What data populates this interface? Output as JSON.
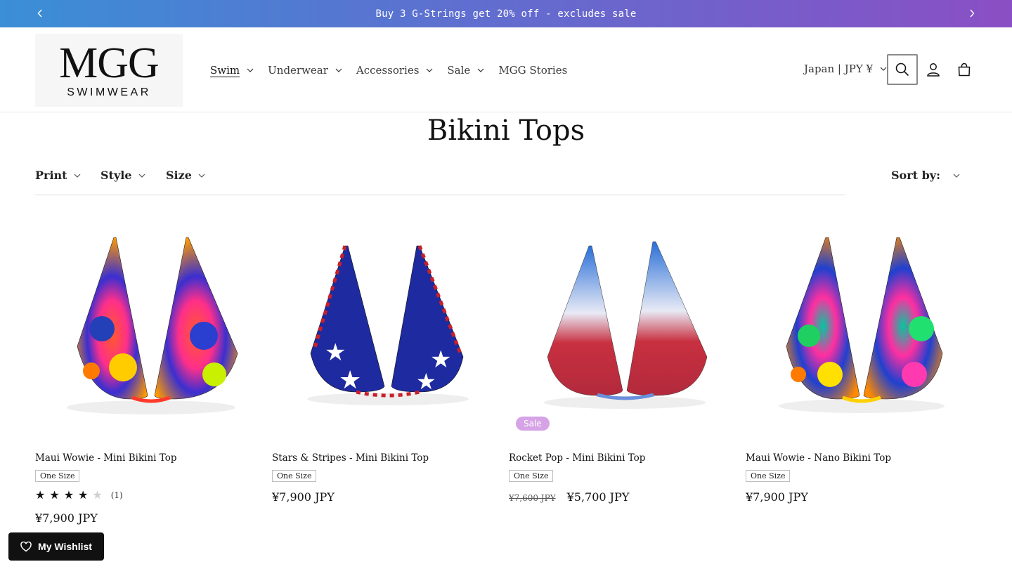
{
  "announcement": {
    "message": "Buy 3 G-Strings get 20% off - excludes sale",
    "prev_icon": "chevron-left-icon",
    "next_icon": "chevron-right-icon",
    "gradient_colors": [
      "#3a8fd6",
      "#8a4fc4"
    ]
  },
  "header": {
    "logo_main": "MGG",
    "logo_sub": "SWIMWEAR",
    "nav": [
      {
        "label": "Swim",
        "has_dropdown": true,
        "active": true
      },
      {
        "label": "Underwear",
        "has_dropdown": true
      },
      {
        "label": "Accessories",
        "has_dropdown": true
      },
      {
        "label": "Sale",
        "has_dropdown": true
      },
      {
        "label": "MGG Stories",
        "has_dropdown": false
      }
    ],
    "country_selector": "Japan | JPY ¥",
    "icons": [
      "search-icon",
      "account-icon",
      "cart-icon"
    ]
  },
  "page": {
    "title": "Bikini Tops"
  },
  "filters": {
    "items": [
      "Print",
      "Style",
      "Size"
    ],
    "sort_label": "Sort by:"
  },
  "products": [
    {
      "name": "Maui Wowie - Mini Bikini Top",
      "size": "One Size",
      "rating": 4,
      "rating_max": 5,
      "review_count": "(1)",
      "price": "¥7,900 JPY",
      "pattern": "tropical-floral"
    },
    {
      "name": "Stars & Stripes - Mini Bikini Top",
      "size": "One Size",
      "price": "¥7,900 JPY",
      "pattern": "stars-and-stripes"
    },
    {
      "name": "Rocket Pop - Mini Bikini Top",
      "size": "One Size",
      "badge": "Sale",
      "compare_price": "¥7,600 JPY",
      "price": "¥5,700 JPY",
      "pattern": "tie-dye"
    },
    {
      "name": "Maui Wowie - Nano Bikini Top",
      "size": "One Size",
      "price": "¥7,900 JPY",
      "pattern": "tropical-floral"
    }
  ],
  "wishlist": {
    "label": "My Wishlist",
    "icon": "heart-icon"
  }
}
